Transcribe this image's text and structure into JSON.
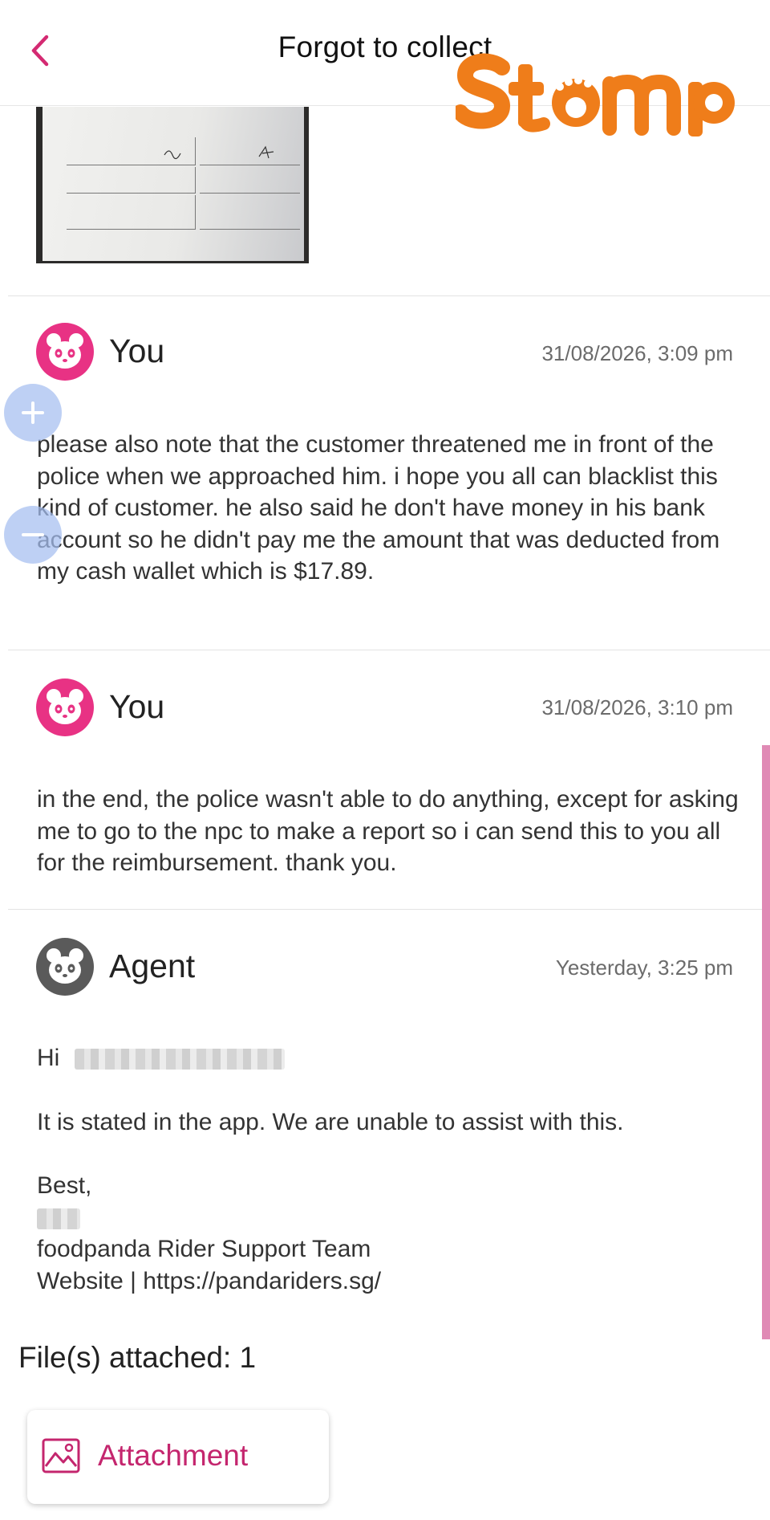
{
  "header": {
    "back_icon": "chevron-left-icon",
    "title": "Forgot to collect",
    "watermark": "Stomp"
  },
  "colors": {
    "brand_pink": "#e83284",
    "attachment_text": "#c4266e",
    "agent_avatar": "#5a5a5a",
    "watermark": "#ef7d1a"
  },
  "messages": [
    {
      "sender": "You",
      "timestamp": "31/08/2026, 3:09 pm",
      "avatar_icon": "panda-icon",
      "text": "please also note that the customer threatened me in front of the police when we approached him. i hope you all can blacklist this kind of customer. he also said he don't have money in his bank account so he didn't pay me the amount that was deducted from my cash wallet which is $17.89."
    },
    {
      "sender": "You",
      "timestamp": "31/08/2026, 3:10 pm",
      "avatar_icon": "panda-icon",
      "text": "in the end, the police wasn't able to do anything, except for asking me to go to the npc to make a report so i can send this to you all for the reimbursement. thank you."
    },
    {
      "sender": "Agent",
      "timestamp": "Yesterday, 3:25 pm",
      "avatar_icon": "panda-icon",
      "greeting": "Hi",
      "body": "It is stated in the app. We are unable to assist with this.",
      "signoff": "Best,",
      "team": "foodpanda Rider Support Team",
      "website": "Website | https://pandariders.sg/"
    }
  ],
  "files_attached": "File(s) attached: 1",
  "attachment": {
    "label": "Attachment",
    "icon": "image-icon"
  },
  "zoom_controls": {
    "plus": "+",
    "minus": "−"
  }
}
